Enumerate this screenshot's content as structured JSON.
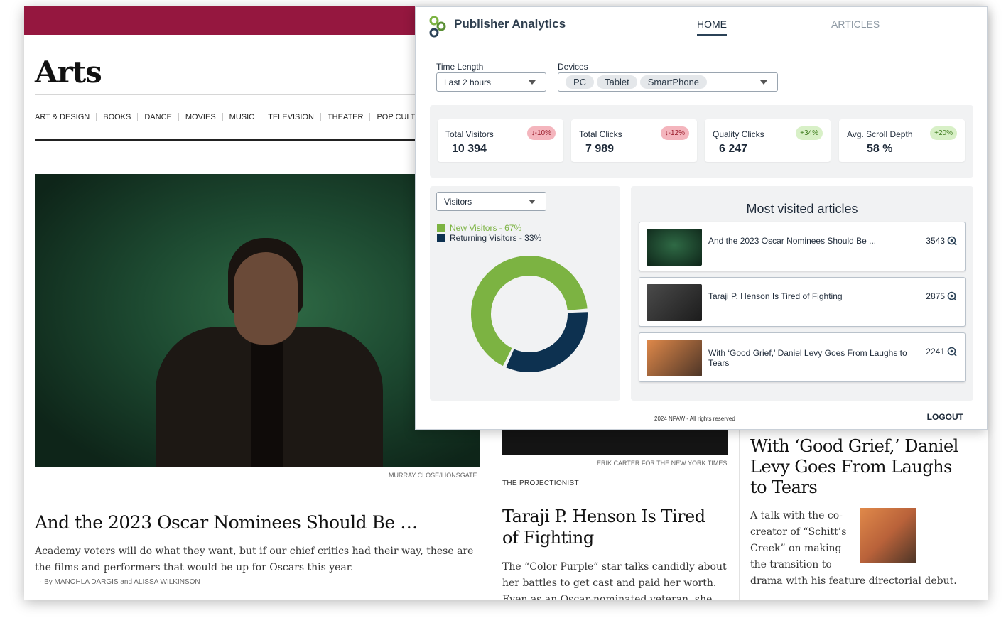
{
  "newspaper": {
    "section_title": "Arts",
    "sections": [
      "ART & DESIGN",
      "BOOKS",
      "DANCE",
      "MOVIES",
      "MUSIC",
      "TELEVISION",
      "THEATER",
      "POP CULTURE"
    ],
    "story1": {
      "photo_credit": "MURRAY CLOSE/LIONSGATE",
      "headline": "And the 2023 Oscar Nominees Should Be …",
      "summary": "Academy voters will do what they want, but if our chief critics had their way, these are the films and performers that would be up for Oscars this year.",
      "byline": "By MANOHLA DARGIS and ALISSA WILKINSON"
    },
    "story2": {
      "photo_credit": "ERIK CARTER FOR THE NEW YORK TIMES",
      "kicker": "THE PROJECTIONIST",
      "headline": "Taraji P. Henson Is Tired of Fighting",
      "summary": "The “Color Purple” star talks candidly about her battles to get cast and paid her worth. Even as an Oscar-nominated veteran, she"
    },
    "story3": {
      "headline": "With ‘Good Grief,’ Daniel Levy Goes From Laughs to Tears",
      "summary_wrap": "A talk with the co-creator of “Schitt’s Creek” on making the transition to",
      "summary_tail": "drama with his feature directorial debut."
    }
  },
  "analytics": {
    "brand": "Publisher Analytics",
    "nav": {
      "home": "HOME",
      "articles": "ARTICLES"
    },
    "filters": {
      "time_label": "Time Length",
      "time_value": "Last 2 hours",
      "devices_label": "Devices",
      "devices": [
        "PC",
        "Tablet",
        "SmartPhone"
      ]
    },
    "stats": [
      {
        "label": "Total Visitors",
        "value": "10 394",
        "change": "↓-10%",
        "trend": "neg"
      },
      {
        "label": "Total Clicks",
        "value": "7 989",
        "change": "↓-12%",
        "trend": "neg"
      },
      {
        "label": "Quality Clicks",
        "value": "6 247",
        "change": "+34%",
        "trend": "pos"
      },
      {
        "label": "Avg. Scroll Depth",
        "value": "58 %",
        "change": "+20%",
        "trend": "pos"
      }
    ],
    "visitors": {
      "select_value": "Visitors",
      "legend": [
        {
          "label": "New Visitors - 67%",
          "color": "#7cb342"
        },
        {
          "label": "Returning Visitors - 33%",
          "color": "#0d3150"
        }
      ]
    },
    "chart_data": {
      "type": "pie",
      "categories": [
        "New Visitors",
        "Returning Visitors"
      ],
      "values": [
        67,
        33
      ],
      "colors": [
        "#7cb342",
        "#0d3150"
      ]
    },
    "most_visited": {
      "title": "Most visited articles",
      "items": [
        {
          "title": "And the 2023 Oscar Nominees Should Be ...",
          "count": "3543"
        },
        {
          "title": "Taraji P. Henson Is Tired of Fighting",
          "count": "2875"
        },
        {
          "title": "With ‘Good Grief,’ Daniel Levy Goes From Laughs to Tears",
          "count": "2241"
        }
      ]
    },
    "footer": {
      "copyright": "2024 NPAW - All rights reserved",
      "logout": "LOGOUT"
    }
  }
}
